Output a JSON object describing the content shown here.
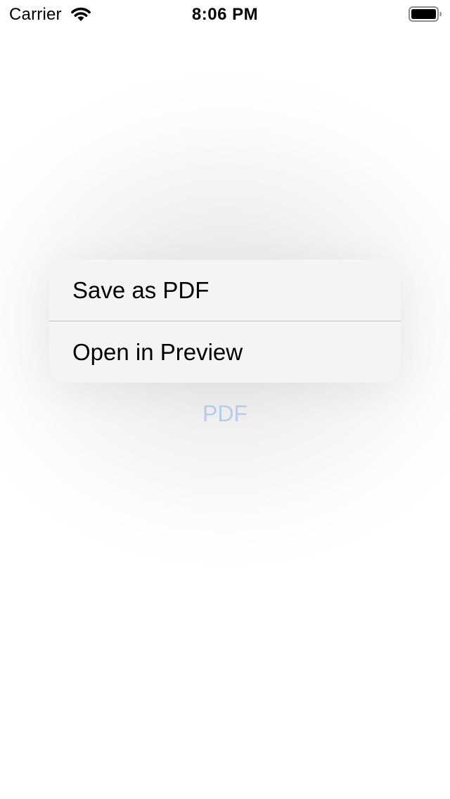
{
  "status_bar": {
    "carrier": "Carrier",
    "time": "8:06 PM",
    "wifi_icon": "wifi-icon",
    "battery_icon": "battery-icon"
  },
  "context_menu": {
    "items": [
      {
        "label": "Save as PDF"
      },
      {
        "label": "Open in Preview"
      }
    ]
  },
  "source_button": {
    "label": "PDF",
    "color": "#b5cdea"
  }
}
